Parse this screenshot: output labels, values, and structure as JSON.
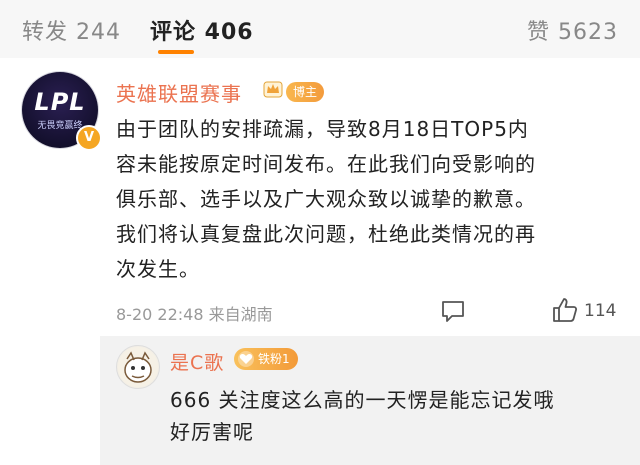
{
  "tabs": {
    "repost": "转发 244",
    "comments": "评论 406",
    "likes": "赞 5623"
  },
  "comment": {
    "avatar_logo": "LPL",
    "avatar_subtitle": "无畏竞赢终",
    "author": "英雄联盟赛事",
    "author_tag": "博主",
    "lines": [
      "由于团队的安排疏漏，导致8月18日TOP5内",
      "容未能按原定时间发布。在此我们向受影响的",
      "俱乐部、选手以及广大观众致以诚挚的歉意。",
      "我们将认真复盘此次问题，杜绝此类情况的再",
      "次发生。"
    ],
    "meta": "8-20 22:48  来自湖南",
    "like_count": "114"
  },
  "reply": {
    "author": "是C歌",
    "badge": "铁粉1",
    "lines": [
      "666 关注度这么高的一天愣是能忘记发哦",
      "好厉害呢"
    ]
  },
  "colors": {
    "accent": "#ff8200",
    "name": "#eb7350",
    "badge": "#f5a623",
    "muted": "#999999"
  },
  "icons": [
    "crown-icon",
    "verified-icon",
    "reply-icon",
    "like-icon",
    "fan-heart-icon"
  ]
}
